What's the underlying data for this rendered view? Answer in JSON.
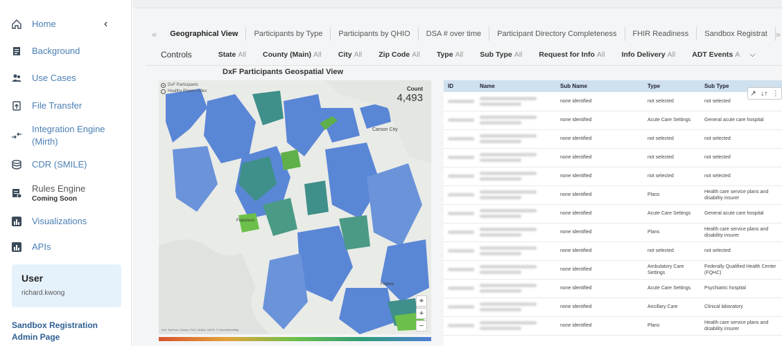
{
  "sidebar": {
    "collapse_icon": "chevron-left-icon",
    "items": [
      {
        "label": "Home",
        "sub": "",
        "icon": "home-icon"
      },
      {
        "label": "Background",
        "sub": "",
        "icon": "document-icon"
      },
      {
        "label": "Use Cases",
        "sub": "",
        "icon": "users-icon"
      },
      {
        "label": "File Transfer",
        "sub": "",
        "icon": "file-upload-icon"
      },
      {
        "label": "Integration Engine (Mirth)",
        "sub": "",
        "icon": "transfer-arrows-icon"
      },
      {
        "label": "CDR (SMILE)",
        "sub": "",
        "icon": "database-icon"
      },
      {
        "label": "Rules Engine",
        "sub": "Coming Soon",
        "icon": "rules-icon"
      },
      {
        "label": "Visualizations",
        "sub": "",
        "icon": "bar-chart-icon"
      },
      {
        "label": "APIs",
        "sub": "",
        "icon": "bar-chart-icon"
      }
    ],
    "user": {
      "title": "User",
      "name": "richard.kwong"
    },
    "sandbox_link": "Sandbox Registration Admin Page"
  },
  "tabs": {
    "left_arrow": "«",
    "right_arrow": "»",
    "items": [
      "Geographical View",
      "Participants by Type",
      "Participants by QHIO",
      "DSA # over time",
      "Participant Directory Completeness",
      "FHIR Readiness",
      "Sandbox Registrat"
    ],
    "active_index": 0
  },
  "controls": {
    "title": "Controls",
    "filters": [
      {
        "label": "State",
        "value": "All"
      },
      {
        "label": "County (Main)",
        "value": "All"
      },
      {
        "label": "City",
        "value": "All"
      },
      {
        "label": "Zip Code",
        "value": "All"
      },
      {
        "label": "Type",
        "value": "All"
      },
      {
        "label": "Sub Type",
        "value": "All"
      },
      {
        "label": "Request for Info",
        "value": "All"
      },
      {
        "label": "Info Delivery",
        "value": "All"
      },
      {
        "label": "ADT Events",
        "value": "A"
      }
    ],
    "expand_icon": "chevron-down-icon"
  },
  "map": {
    "title": "DxF Participants Geospatial View",
    "legend": [
      "DxF Participants",
      "Healthy Places Index"
    ],
    "count_label": "Count",
    "count_value": "4,493",
    "place_labels": [
      "Carson City",
      "Francisco",
      "Fresno"
    ],
    "credit": "Esri, TomTom, Garmin, FAO, NOAA, USGS, © OpenStreetMap",
    "zoom_in": "+",
    "zoom_out": "−",
    "locate_icon": "locate-icon"
  },
  "table": {
    "tools": [
      "↗",
      "↓↑",
      "⋮"
    ],
    "columns": [
      "ID",
      "Name",
      "Sub Name",
      "Type",
      "Sub Type"
    ],
    "rows": [
      {
        "sub_name": "none identified",
        "type": "not selected",
        "sub_type": "not selected"
      },
      {
        "sub_name": "none identified",
        "type": "Acute Care Settings",
        "sub_type": "General acute care hospital"
      },
      {
        "sub_name": "none identified",
        "type": "not selected",
        "sub_type": "not selected"
      },
      {
        "sub_name": "none identified",
        "type": "not selected",
        "sub_type": "not selected"
      },
      {
        "sub_name": "none identified",
        "type": "not selected",
        "sub_type": "not selected"
      },
      {
        "sub_name": "none identified",
        "type": "Plans",
        "sub_type": "Health care service plans and disability insurer"
      },
      {
        "sub_name": "none identified",
        "type": "Acute Care Settings",
        "sub_type": "General acute care hospital"
      },
      {
        "sub_name": "none identified",
        "type": "Plans",
        "sub_type": "Health care service plans and disability insurer"
      },
      {
        "sub_name": "none identified",
        "type": "not selected",
        "sub_type": "not selected"
      },
      {
        "sub_name": "none identified",
        "type": "Ambulatory Care Settings",
        "sub_type": "Federally Qualified Health Center (FQHC)"
      },
      {
        "sub_name": "none identified",
        "type": "Acute Care Settings",
        "sub_type": "Psychiatric hospital"
      },
      {
        "sub_name": "none identified",
        "type": "Ancillary Care",
        "sub_type": "Clinical laboratory"
      },
      {
        "sub_name": "none identified",
        "type": "Plans",
        "sub_type": "Health care service plans and disability insurer"
      }
    ]
  },
  "colors": {
    "accent": "#4a7fb5",
    "header_row": "#cfe0ee",
    "map_blue": "#5a86d6",
    "map_teal": "#3f8f8a",
    "map_green": "#5fb04a"
  }
}
